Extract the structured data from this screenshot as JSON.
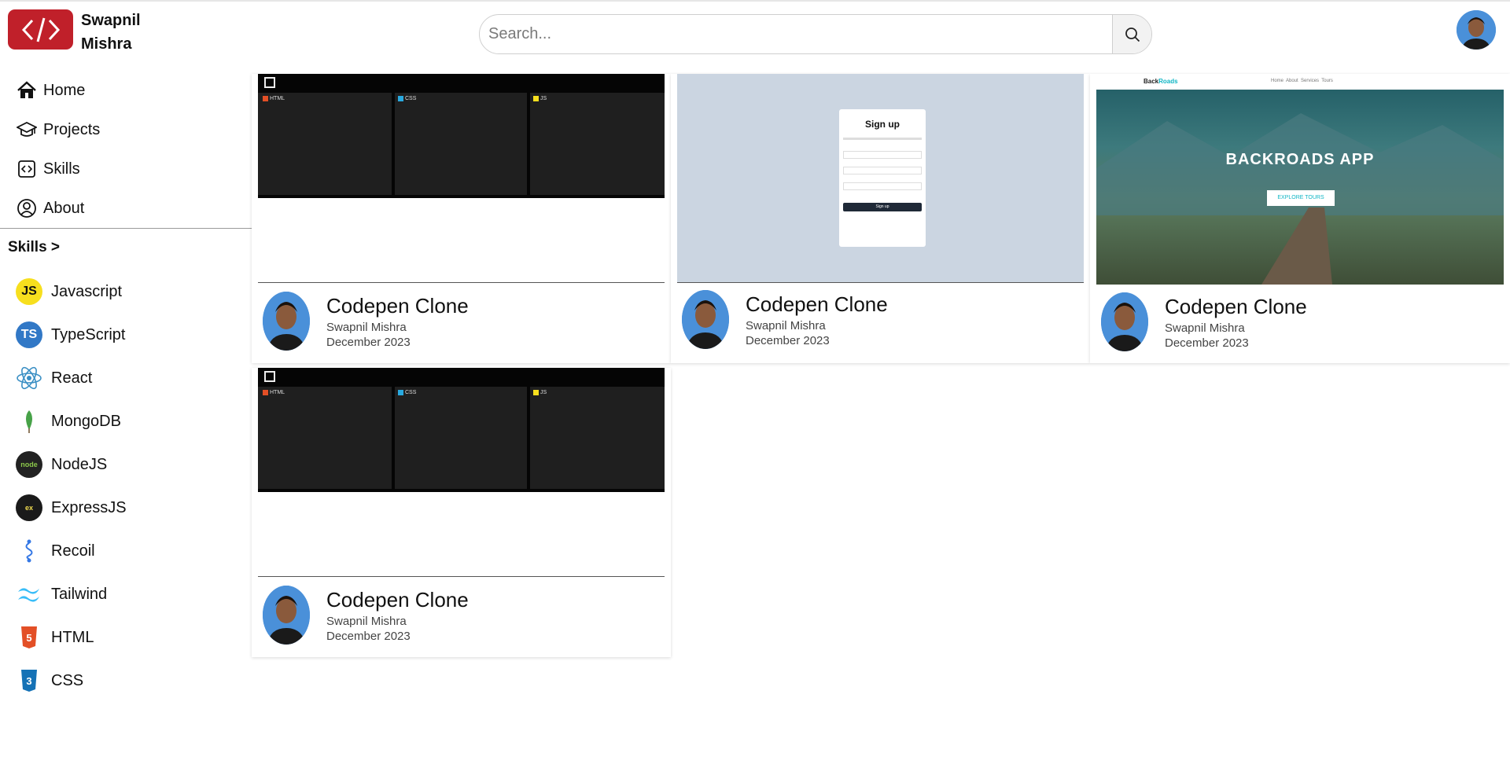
{
  "brand": {
    "name": "Swapnil Mishra"
  },
  "search": {
    "placeholder": "Search..."
  },
  "nav": [
    {
      "label": "Home",
      "icon": "home-icon"
    },
    {
      "label": "Projects",
      "icon": "graduation-cap-icon"
    },
    {
      "label": "Skills",
      "icon": "code-icon"
    },
    {
      "label": "About",
      "icon": "user-circle-icon"
    }
  ],
  "skills": {
    "title": "Skills >",
    "items": [
      {
        "label": "Javascript",
        "icon": "javascript-icon"
      },
      {
        "label": "TypeScript",
        "icon": "typescript-icon"
      },
      {
        "label": "React",
        "icon": "react-icon"
      },
      {
        "label": "MongoDB",
        "icon": "mongodb-icon"
      },
      {
        "label": "NodeJS",
        "icon": "nodejs-icon"
      },
      {
        "label": "ExpressJS",
        "icon": "expressjs-icon"
      },
      {
        "label": "Recoil",
        "icon": "recoil-icon"
      },
      {
        "label": "Tailwind",
        "icon": "tailwind-icon"
      },
      {
        "label": "HTML",
        "icon": "html-icon"
      },
      {
        "label": "CSS",
        "icon": "css-icon"
      }
    ]
  },
  "cards": [
    {
      "title": "Codepen Clone",
      "author": "Swapnil Mishra",
      "date": "December 2023",
      "thumb": "codepen"
    },
    {
      "title": "Codepen Clone",
      "author": "Swapnil Mishra",
      "date": "December 2023",
      "thumb": "signup"
    },
    {
      "title": "Codepen Clone",
      "author": "Swapnil Mishra",
      "date": "December 2023",
      "thumb": "backroads"
    },
    {
      "title": "Codepen Clone",
      "author": "Swapnil Mishra",
      "date": "December 2023",
      "thumb": "codepen"
    }
  ],
  "thumbs": {
    "codepen": {
      "tabs": [
        "HTML",
        "CSS",
        "JS"
      ]
    },
    "signup": {
      "heading": "Sign up",
      "button": "Sign up"
    },
    "backroads": {
      "logo_a": "Back",
      "logo_b": "Roads",
      "links": "Home  About  Services  Tours",
      "headline": "BACKROADS APP",
      "button": "EXPLORE TOURS"
    }
  },
  "colors": {
    "logo_bg": "#c0202a",
    "avatar_bg": "#4a90d9"
  }
}
